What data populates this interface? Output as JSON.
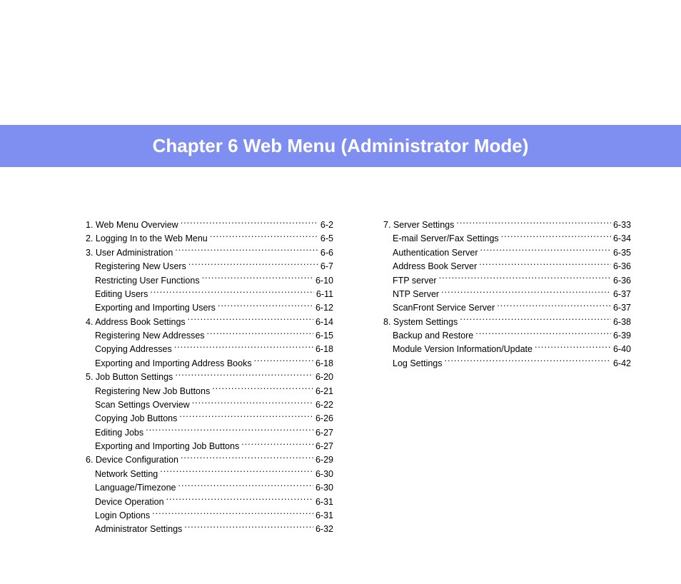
{
  "title": "Chapter 6   Web Menu (Administrator Mode)",
  "columns": [
    [
      {
        "label": "1. Web Menu Overview",
        "page": "6-2",
        "sub": false
      },
      {
        "label": "2. Logging In to the Web Menu",
        "page": "6-5",
        "sub": false
      },
      {
        "label": "3. User Administration",
        "page": "6-6",
        "sub": false
      },
      {
        "label": "Registering New Users",
        "page": "6-7",
        "sub": true
      },
      {
        "label": "Restricting User Functions",
        "page": "6-10",
        "sub": true
      },
      {
        "label": "Editing Users",
        "page": "6-11",
        "sub": true
      },
      {
        "label": "Exporting and Importing Users",
        "page": "6-12",
        "sub": true
      },
      {
        "label": "4. Address Book Settings",
        "page": "6-14",
        "sub": false
      },
      {
        "label": "Registering New Addresses",
        "page": "6-15",
        "sub": true
      },
      {
        "label": "Copying Addresses",
        "page": "6-18",
        "sub": true
      },
      {
        "label": "Exporting and Importing Address Books",
        "page": "6-18",
        "sub": true
      },
      {
        "label": "5. Job Button Settings",
        "page": "6-20",
        "sub": false
      },
      {
        "label": "Registering New Job Buttons",
        "page": "6-21",
        "sub": true
      },
      {
        "label": "Scan Settings Overview",
        "page": "6-22",
        "sub": true
      },
      {
        "label": "Copying Job Buttons",
        "page": "6-26",
        "sub": true
      },
      {
        "label": "Editing Jobs",
        "page": "6-27",
        "sub": true
      },
      {
        "label": "Exporting and Importing Job Buttons",
        "page": "6-27",
        "sub": true
      },
      {
        "label": "6. Device Configuration",
        "page": "6-29",
        "sub": false
      },
      {
        "label": "Network Setting",
        "page": "6-30",
        "sub": true
      },
      {
        "label": "Language/Timezone",
        "page": "6-30",
        "sub": true
      },
      {
        "label": "Device Operation",
        "page": "6-31",
        "sub": true
      },
      {
        "label": "Login Options",
        "page": "6-31",
        "sub": true
      },
      {
        "label": "Administrator Settings",
        "page": "6-32",
        "sub": true
      }
    ],
    [
      {
        "label": "7. Server Settings",
        "page": "6-33",
        "sub": false
      },
      {
        "label": "E-mail Server/Fax Settings",
        "page": "6-34",
        "sub": true
      },
      {
        "label": "Authentication Server",
        "page": "6-35",
        "sub": true
      },
      {
        "label": "Address Book Server",
        "page": "6-36",
        "sub": true
      },
      {
        "label": "FTP server",
        "page": "6-36",
        "sub": true
      },
      {
        "label": "NTP Server",
        "page": "6-37",
        "sub": true
      },
      {
        "label": "ScanFront Service Server",
        "page": "6-37",
        "sub": true
      },
      {
        "label": "8. System Settings",
        "page": "6-38",
        "sub": false
      },
      {
        "label": "Backup and Restore",
        "page": "6-39",
        "sub": true
      },
      {
        "label": "Module Version Information/Update",
        "page": "6-40",
        "sub": true
      },
      {
        "label": "Log Settings",
        "page": "6-42",
        "sub": true
      }
    ]
  ]
}
